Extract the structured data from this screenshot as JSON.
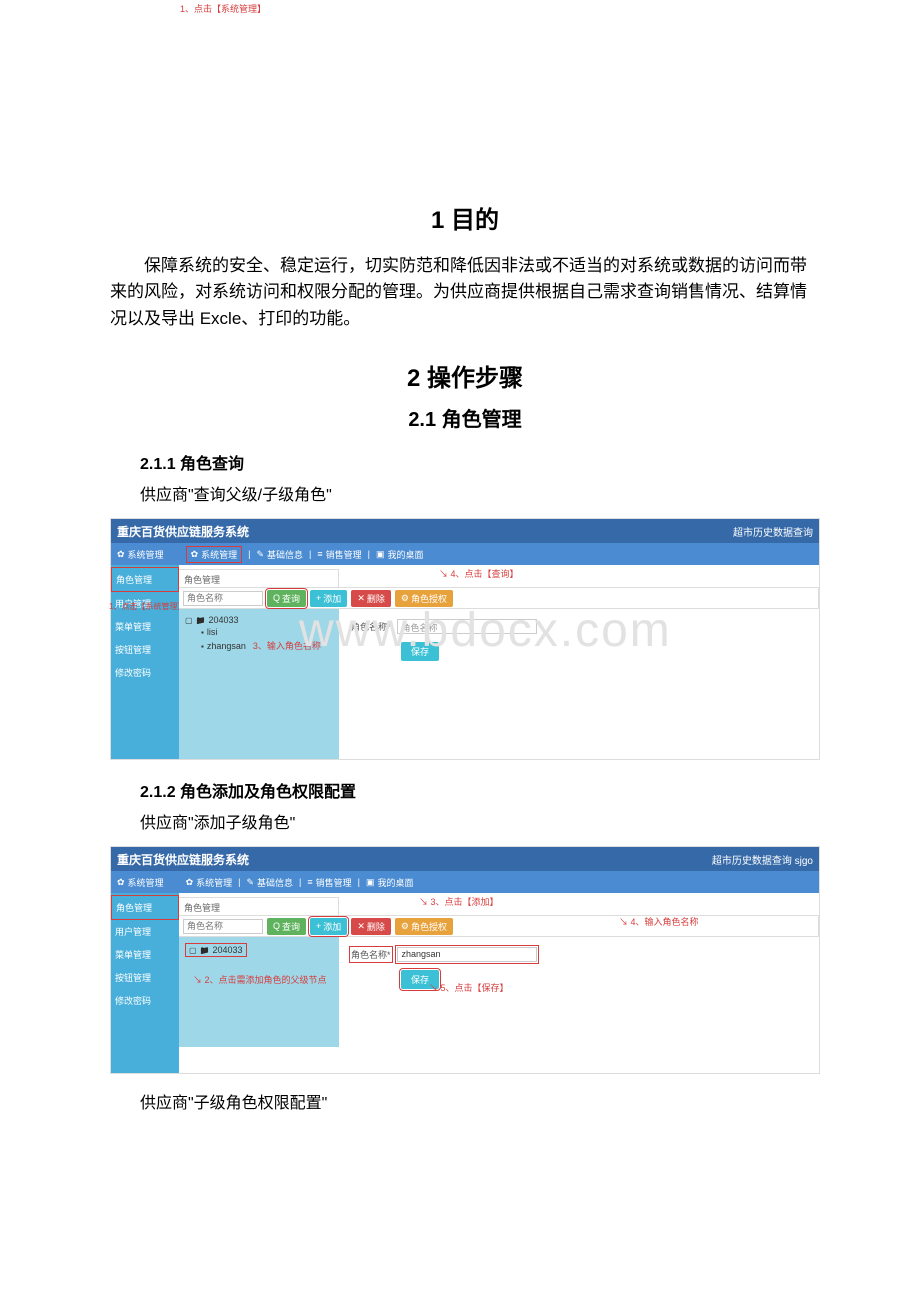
{
  "doc": {
    "h1": "1 目的",
    "p1": "保障系统的安全、稳定运行，切实防范和降低因非法或不适当的对系统或数据的访问而带来的风险，对系统访问和权限分配的管理。为供应商提供根据自己需求查询销售情况、结算情况以及导出 Excle、打印的功能。",
    "h2": "2 操作步骤",
    "h3": "2.1 角色管理",
    "h4a": "2.1.1 角色查询",
    "pa": "供应商\"查询父级/子级角色\"",
    "h4b": "2.1.2 角色添加及角色权限配置",
    "pb": "供应商\"添加子级角色\"",
    "pc": "供应商\"子级角色权限配置\""
  },
  "app1": {
    "title": "重庆百货供应链服务系统",
    "header_right": "超市历史数据查询",
    "crumbs": {
      "sys": "系统管理",
      "c1": "系统管理",
      "c2": "基础信息",
      "c3": "销售管理",
      "c4": "我的桌面"
    },
    "side": [
      "角色管理",
      "用户管理",
      "菜单管理",
      "按钮管理",
      "修改密码"
    ],
    "side_annot": "1、点击【系统管理】",
    "panel_title": "角色管理",
    "toolbar": {
      "placeholder": "角色名称",
      "search": "查询",
      "add": "添加",
      "del": "删除",
      "perm": "角色授权"
    },
    "annot_top": "1、点击【系统管理】",
    "annot_search": "4、点击【查询】",
    "tree": {
      "root": "204033",
      "c1": "lisi",
      "c2": "zhangsan"
    },
    "tree_annot": "3、输入角色名称",
    "form": {
      "label": "角色名称*",
      "value": "角色名称",
      "save": "保存"
    },
    "watermark": "www.bdocx.com"
  },
  "app2": {
    "title": "重庆百货供应链服务系统",
    "header_right": "超市历史数据查询   sjgo",
    "crumbs": {
      "sys": "系统管理",
      "c1": "系统管理",
      "c2": "基础信息",
      "c3": "销售管理",
      "c4": "我的桌面"
    },
    "side": [
      "角色管理",
      "用户管理",
      "菜单管理",
      "按钮管理",
      "修改密码"
    ],
    "panel_title": "角色管理",
    "toolbar": {
      "placeholder": "角色名称",
      "search": "查询",
      "add": "添加",
      "del": "删除",
      "perm": "角色授权"
    },
    "annot_add": "3、点击【添加】",
    "annot_input": "4、输入角色名称",
    "tree": {
      "root": "204033"
    },
    "tree_annot": "2、点击需添加角色的父级节点",
    "form": {
      "label": "角色名称*",
      "value": "zhangsan",
      "save": "保存"
    },
    "annot_save": "5、点击【保存】"
  }
}
